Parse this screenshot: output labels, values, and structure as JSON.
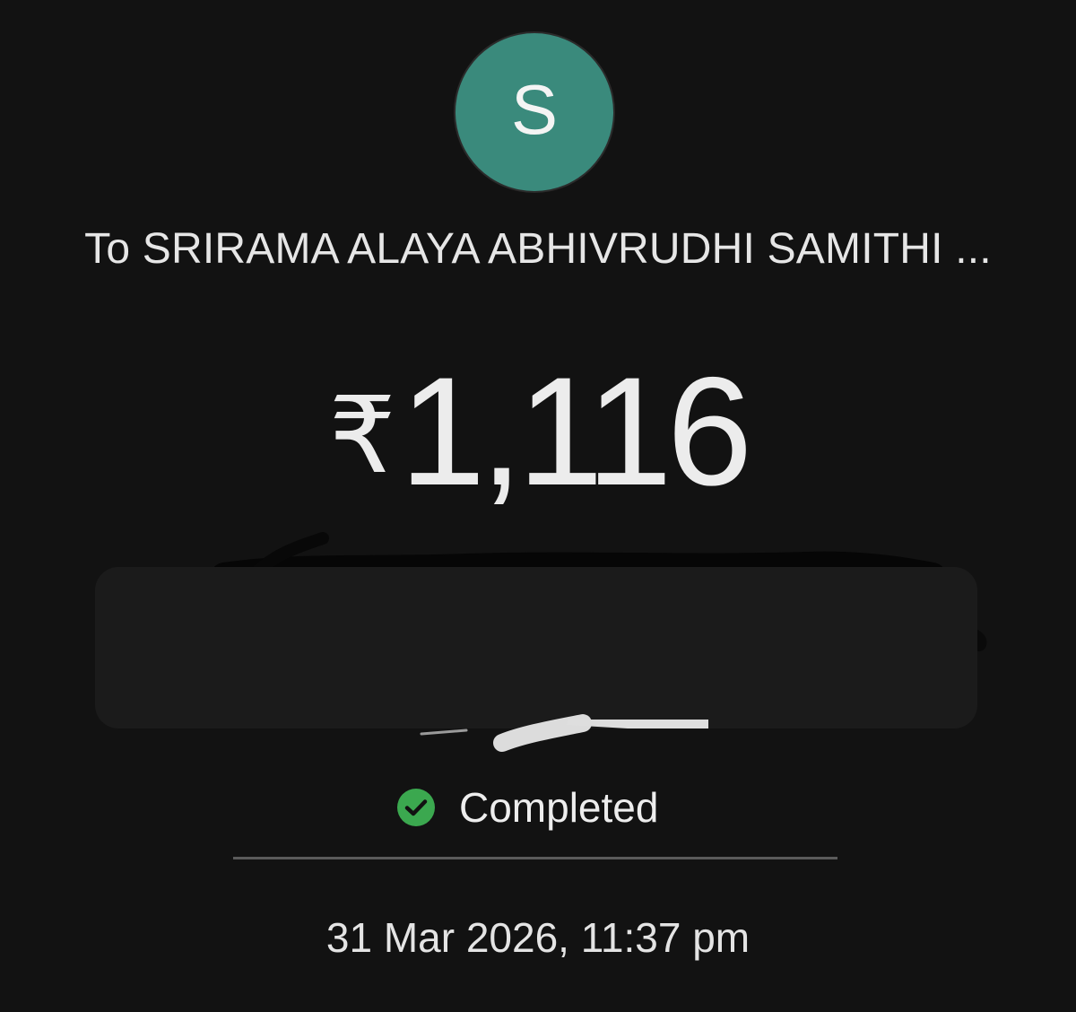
{
  "avatar": {
    "letter": "S",
    "color": "#3a8a7c"
  },
  "recipient": {
    "text": "To SRIRAMA ALAYA ABHIVRUDHI SAMITHI ..."
  },
  "amount": {
    "currency_symbol": "₹",
    "value": "1,116"
  },
  "status": {
    "icon": "check-circle-icon",
    "label": "Completed",
    "color": "#3ba84f"
  },
  "timestamp": {
    "text": "31 Mar 2026, 11:37 pm"
  },
  "colors": {
    "background": "#121212",
    "text": "#e8e8e8",
    "divider": "#5a5a5a"
  }
}
